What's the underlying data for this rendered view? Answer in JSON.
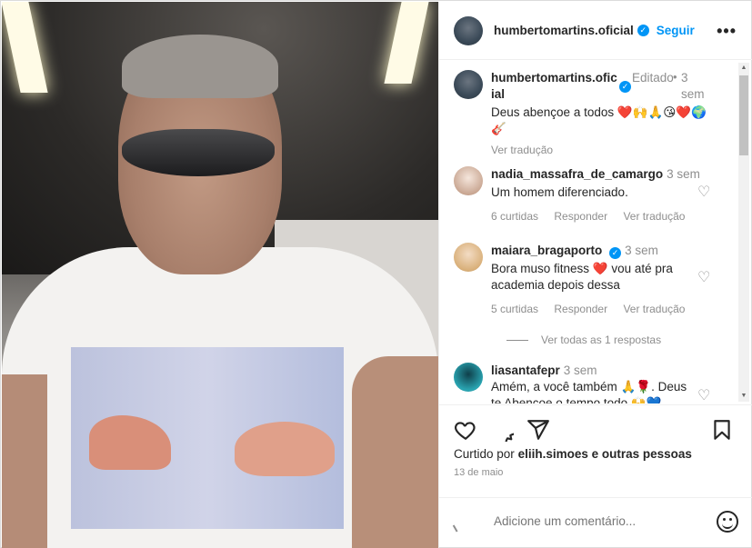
{
  "post": {
    "username": "humbertomartins.oficial",
    "follow_label": "Seguir",
    "more_icon": "more-options-icon",
    "verified_icon": "verified-badge-icon"
  },
  "caption": {
    "username": "humbertomartins.oficial",
    "edited": "Editado",
    "dot": "•",
    "time": "3 sem",
    "text": "Deus abençoe a todos ❤️🙌🙏😘❤️🌍🎸",
    "translate": "Ver tradução"
  },
  "comments": [
    {
      "username": "nadia_massafra_de_camargo",
      "time": "3 sem",
      "text": "Um homem diferenciado.",
      "likes": "6 curtidas",
      "reply": "Responder",
      "translate": "Ver tradução",
      "verified": false,
      "avatar_color": "#e8d3c6"
    },
    {
      "username": "maiara_bragaporto",
      "time": "3 sem",
      "text": "Bora muso fitness ❤️ vou até pra academia depois dessa",
      "likes": "5 curtidas",
      "reply": "Responder",
      "translate": "Ver tradução",
      "verified": true,
      "avatar_color": "#d9b07a",
      "view_replies": "Ver todas as 1 respostas"
    },
    {
      "username": "liasantafepr",
      "time": "3 sem",
      "text": "Amém, a você também 🙏🌹. Deus te Abençoe o tempo todo 🙌💙",
      "verified": false,
      "avatar_color": "#2aa6b3"
    }
  ],
  "actions": {
    "like_icon": "heart-icon",
    "comment_icon": "comment-icon",
    "share_icon": "share-icon",
    "save_icon": "bookmark-icon",
    "liked_by_prefix": "Curtido por",
    "liked_by_user": "eliih.simoes",
    "liked_by_suffix": "e outras pessoas",
    "date": "13 de maio"
  },
  "add_comment": {
    "placeholder": "Adicione um comentário...",
    "emoji_icon": "emoji-icon"
  },
  "colors": {
    "accent": "#0095f6",
    "text": "#262626",
    "muted": "#8e8e8e",
    "heart": "#ed4956"
  }
}
